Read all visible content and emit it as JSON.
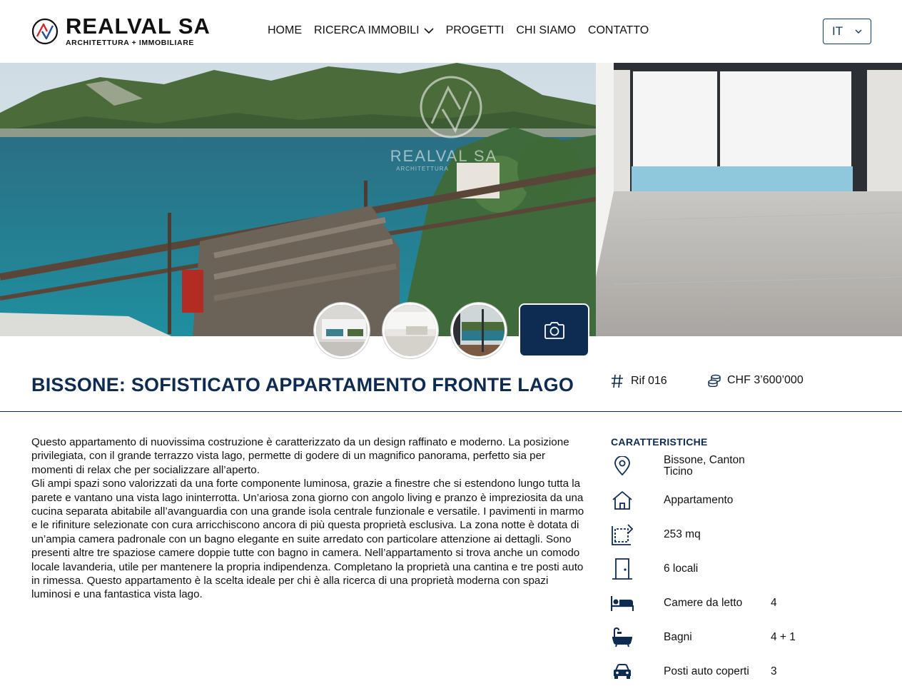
{
  "brand": {
    "name": "REALVAL SA",
    "tagline": "ARCHITETTURA + IMMOBILIARE"
  },
  "nav": {
    "items": [
      {
        "label": "HOME"
      },
      {
        "label": "RICERCA IMMOBILI"
      },
      {
        "label": "PROGETTI"
      },
      {
        "label": "CHI SIAMO"
      },
      {
        "label": "CONTATTO"
      }
    ],
    "language": "IT"
  },
  "listing": {
    "title": "BISSONE: SOFISTICATO APPARTAMENTO FRONTE LAGO",
    "ref": "Rif 016",
    "price": "CHF 3’600’000",
    "description": [
      "Questo appartamento di nuovissima costruzione è caratterizzato da un design raffinato e moderno. La posizione privilegiata, con il grande terrazzo vista lago, permette di godere di un magnifico panorama, perfetto sia per momenti di relax che per socializzare all’aperto.",
      "Gli ampi spazi sono valorizzati da una forte componente luminosa, grazie a finestre che si estendono lungo tutta la parete e vantano una vista lago ininterrotta. Un’ariosa zona giorno con angolo living e pranzo è impreziosita da una cucina separata abitabile all’avanguardia con una grande isola centrale funzionale e versatile. I pavimenti in marmo e le rifiniture selezionate con cura arricchiscono ancora di più questa proprietà esclusiva. La zona notte è dotata di un’ampia camera padronale con un bagno elegante en suite arredato con particolare attenzione ai dettagli. Sono presenti altre tre spaziose camere doppie tutte con bagno in camera. Nell’appartamento si trova anche un comodo locale lavanderia, utile per mantenere la propria indipendenza. Completano la proprietà una cantina e tre posti auto in rimessa. Questo appartamento è la scelta ideale per chi è alla ricerca di una proprietà moderna con spazi luminosi e una fantastica vista lago."
    ]
  },
  "features": {
    "title": "CARATTERISTICHE",
    "items": [
      {
        "icon": "location-pin-icon",
        "label": "Bissone, Canton Ticino",
        "value": ""
      },
      {
        "icon": "house-icon",
        "label": "Appartamento",
        "value": ""
      },
      {
        "icon": "area-icon",
        "label": "253 mq",
        "value": ""
      },
      {
        "icon": "door-icon",
        "label": "6 locali",
        "value": ""
      },
      {
        "icon": "bed-icon",
        "label": "Camere da letto",
        "value": "4"
      },
      {
        "icon": "bathtub-icon",
        "label": "Bagni",
        "value": "4 + 1"
      },
      {
        "icon": "car-icon",
        "label": "Posti auto coperti",
        "value": "3"
      }
    ]
  },
  "gallery": {
    "watermark_name": "REALVAL SA",
    "watermark_tag": "ARCHITETTURA"
  },
  "colors": {
    "primary": "#0e2b52",
    "accent_red": "#d8242e",
    "accent_blue": "#1d4f9c"
  }
}
